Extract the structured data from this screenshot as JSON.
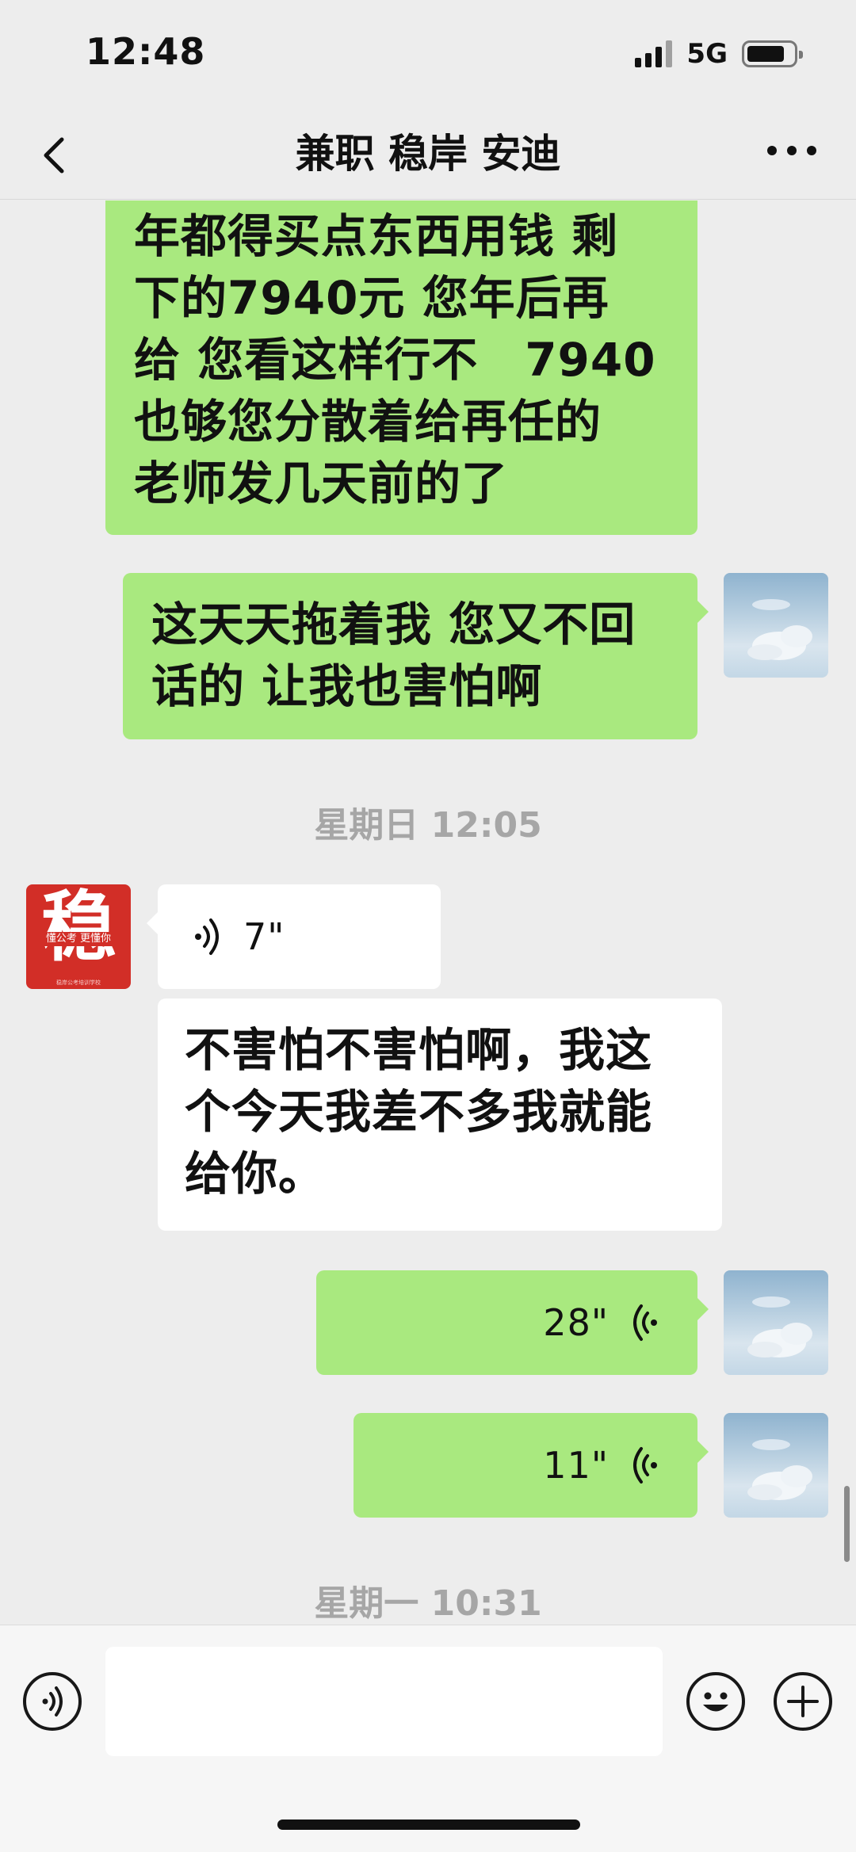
{
  "status_bar": {
    "time": "12:48",
    "network": "5G"
  },
  "nav": {
    "title": "兼职 稳岸 安迪"
  },
  "messages": {
    "m1_lines": [
      "年都得买点东西用钱 剩",
      "下的7940元 您年后再",
      "给 您看这样行不　7940",
      "也够您分散着给再任的",
      "老师发几天前的了"
    ],
    "m2_lines": [
      "这天天拖着我 您又不回",
      "话的 让我也害怕啊"
    ],
    "ts1": "星期日 12:05",
    "voice_in": "7\"",
    "m3_lines": [
      "不害怕不害怕啊，我这",
      "个今天我差不多我就能",
      "给你。"
    ],
    "voice_out_1": "28\"",
    "voice_out_2": "11\"",
    "ts2": "星期一 10:31"
  },
  "contact_avatar": {
    "big_char": "稳",
    "slogan": "懂公考 更懂你",
    "tiny": "稳岸公考培训学校"
  },
  "colors": {
    "my_bubble": "#a9e97f",
    "background": "#ededed",
    "their_bubble": "#ffffff"
  },
  "icons": {
    "back": "chevron-left-icon",
    "more": "more-icon",
    "voice": "voice-icon",
    "emoji": "emoji-icon",
    "add": "plus-icon"
  }
}
